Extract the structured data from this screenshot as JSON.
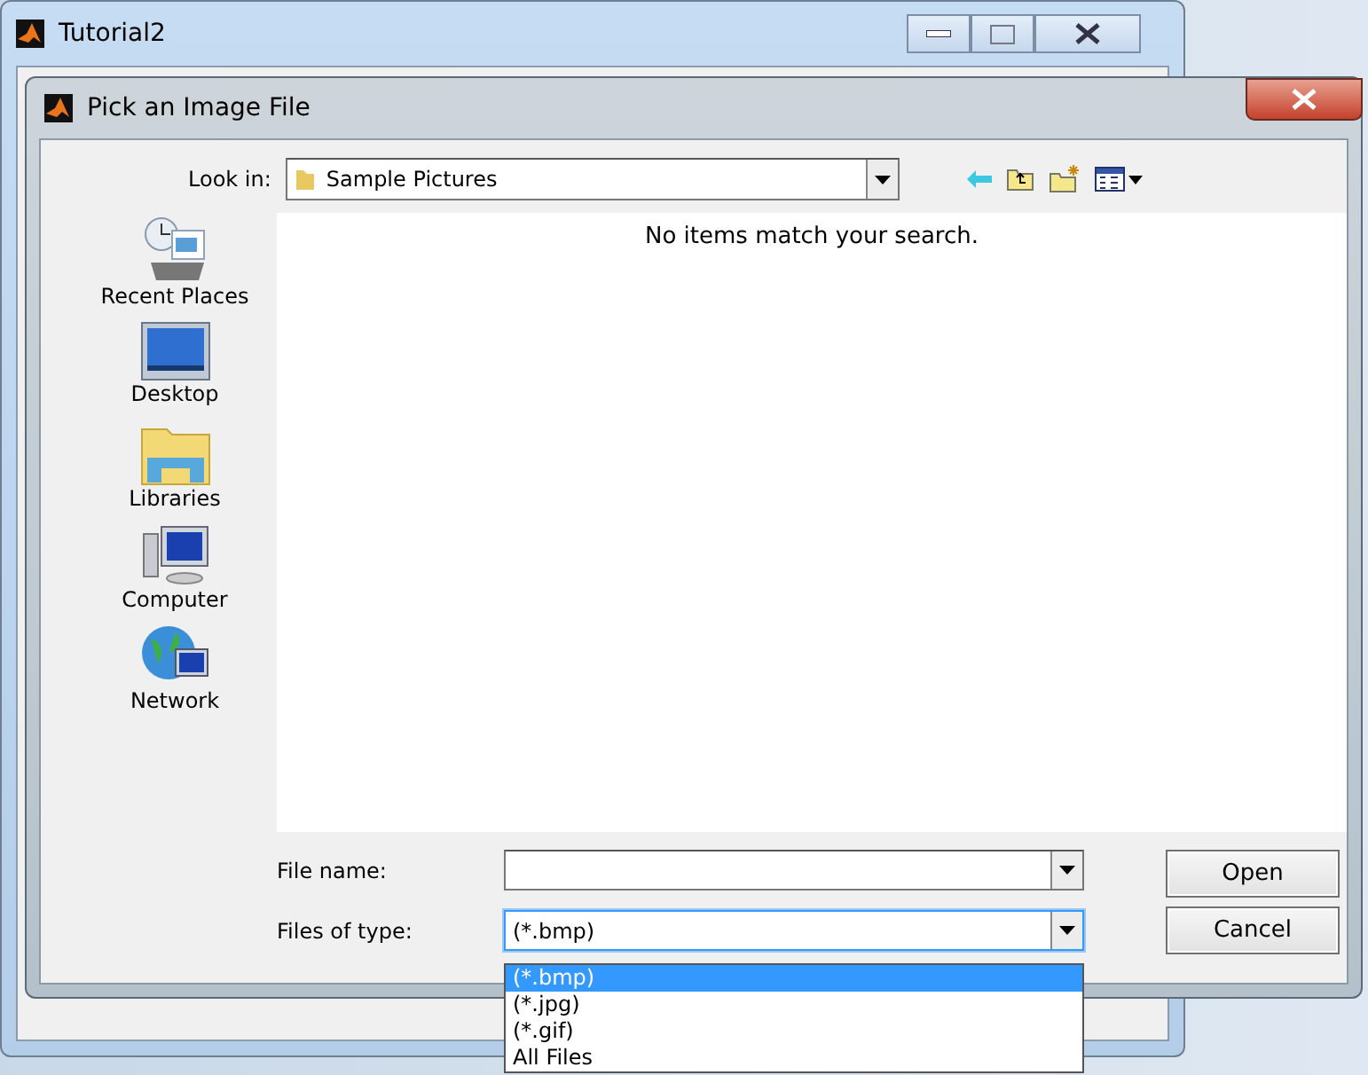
{
  "back_window": {
    "title": "Tutorial2"
  },
  "dialog": {
    "title": "Pick an Image File",
    "look_in": {
      "label": "Look in:",
      "value": "Sample Pictures"
    },
    "places": [
      {
        "kind": "recent",
        "label": "Recent Places"
      },
      {
        "kind": "desktop",
        "label": "Desktop"
      },
      {
        "kind": "libraries",
        "label": "Libraries"
      },
      {
        "kind": "computer",
        "label": "Computer"
      },
      {
        "kind": "network",
        "label": "Network"
      }
    ],
    "empty_message": "No items match your search.",
    "file_name": {
      "label": "File name:"
    },
    "file_type": {
      "label": "Files of type:",
      "value": "(*.bmp)",
      "expanded": true,
      "options": [
        {
          "label": "(*.bmp)",
          "selected": true
        },
        {
          "label": "(*.jpg)",
          "selected": false
        },
        {
          "label": "(*.gif)",
          "selected": false
        },
        {
          "label": "All Files",
          "selected": false
        }
      ]
    },
    "buttons": [
      "Open",
      "Cancel"
    ]
  }
}
